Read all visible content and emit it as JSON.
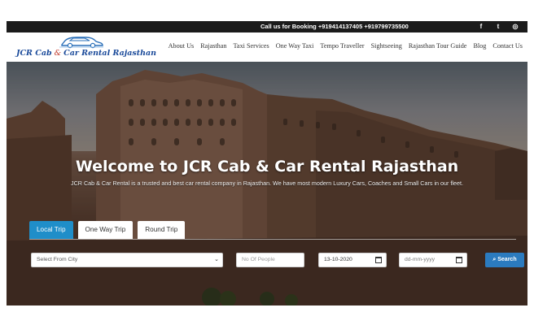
{
  "topbar": {
    "call_text": "Call us for Booking +919414137405 +919799735500",
    "social": [
      {
        "icon": "facebook-icon",
        "glyph": "f"
      },
      {
        "icon": "twitter-icon",
        "glyph": "t"
      },
      {
        "icon": "instagram-icon",
        "glyph": "◎"
      }
    ]
  },
  "logo": {
    "brand_part1": "JCR Cab",
    "brand_amp": "&",
    "brand_part2": "Car Rental Rajasthan"
  },
  "nav": {
    "items": [
      "About Us",
      "Rajasthan",
      "Taxi Services",
      "One Way Taxi",
      "Tempo Traveller",
      "Sightseeing",
      "Rajasthan Tour Guide",
      "Blog",
      "Contact Us"
    ]
  },
  "hero": {
    "title": "Welcome to JCR Cab & Car Rental Rajasthan",
    "subtitle": "JCR Cab & Car Rental is a trusted and best car rental company in Rajasthan. We have most modern Luxury Cars, Coaches and Small Cars in our fleet."
  },
  "booking": {
    "tabs": [
      "Local Trip",
      "One Way Trip",
      "Round Trip"
    ],
    "active_tab": "Local Trip",
    "city_select": "Select From City",
    "people_placeholder": "No Of People",
    "date_value": "13-10-2020",
    "date2_placeholder": "dd-mm-yyyy",
    "search_label": "Search"
  },
  "colors": {
    "accent": "#1f8ec9",
    "search_button": "#2b7bbf",
    "brand_blue": "#1a4a9a",
    "topbar": "#1b1b1b"
  }
}
